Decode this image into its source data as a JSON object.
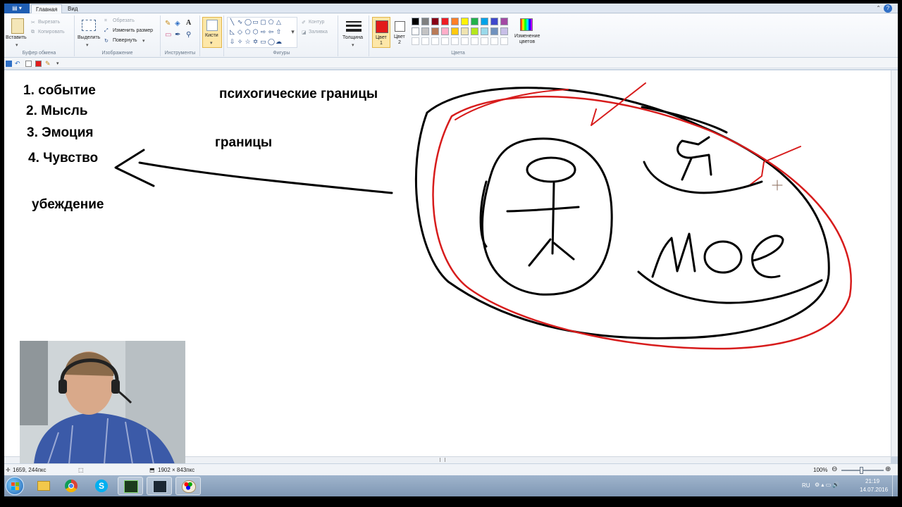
{
  "tabs": {
    "home": "Главная",
    "view": "Вид"
  },
  "clipboard": {
    "paste": "Вставить",
    "cut": "Вырезать",
    "copy": "Копировать",
    "caption": "Буфер обмена"
  },
  "image": {
    "select": "Выделить",
    "crop": "Обрезать",
    "resize": "Изменить размер",
    "rotate": "Повернуть",
    "caption": "Изображение"
  },
  "tools": {
    "caption": "Инструменты"
  },
  "brushes": {
    "label": "Кисти"
  },
  "shapes": {
    "outline": "Контур",
    "fill": "Заливка",
    "caption": "Фигуры"
  },
  "size": {
    "label": "Толщина"
  },
  "colors": {
    "color1_label": "Цвет",
    "color1_num": "1",
    "color2_label": "Цвет",
    "color2_num": "2",
    "caption": "Цвета",
    "edit_line1": "Изменение",
    "edit_line2": "цветов",
    "color1_value": "#e21b1b",
    "color2_value": "#ffffff",
    "palette_row1": [
      "#000000",
      "#7f7f7f",
      "#880015",
      "#ed1c24",
      "#ff7f27",
      "#fff200",
      "#22b14c",
      "#00a2e8",
      "#3f48cc",
      "#a349a4"
    ],
    "palette_row2": [
      "#ffffff",
      "#c3c3c3",
      "#b97a57",
      "#ffaec9",
      "#ffc90e",
      "#efe4b0",
      "#b5e61d",
      "#99d9ea",
      "#7092be",
      "#c8bfe7"
    ]
  },
  "canvas_text": {
    "item1": "1. событие",
    "item2": "2. Мысль",
    "item3": "3. Эмоция",
    "item4": "4. Чувство",
    "belief": "убеждение",
    "title": "психогические границы",
    "boundaries": "границы"
  },
  "status": {
    "cursor": "1659, 244пкс",
    "size": "1902 × 843пкс",
    "zoom": "100%"
  },
  "tray": {
    "lang": "RU",
    "time": "21:19",
    "date": "14.07.2016"
  }
}
